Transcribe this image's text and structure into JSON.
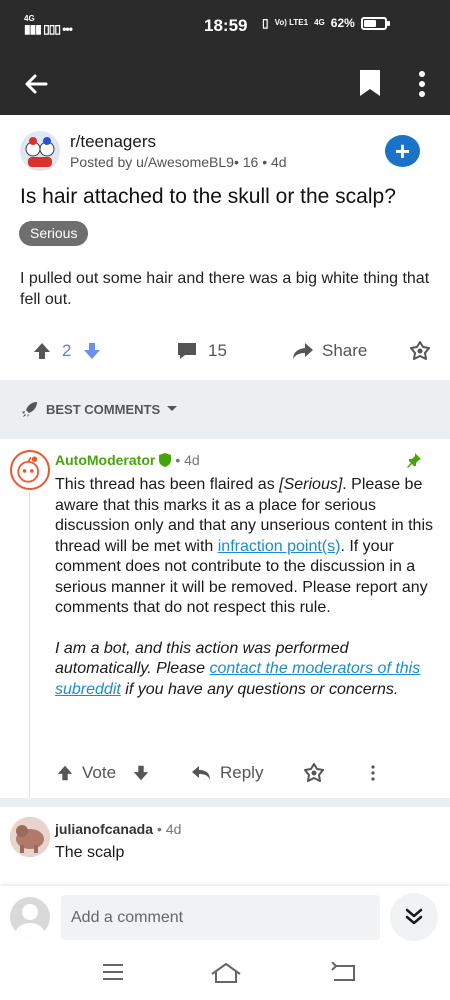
{
  "status_bar": {
    "network": "4G",
    "time": "18:59",
    "vo_lte": "Vo) LTE1",
    "network_right": "4G",
    "battery": "62%",
    "battery_level": 0.62
  },
  "post": {
    "subreddit": "r/teenagers",
    "posted_by": "Posted by u/AwesomeBL9",
    "posted_meta": "• 16 • 4d",
    "join_icon": "plus-icon",
    "title": "Is hair attached to the skull or the scalp?",
    "flair": "Serious",
    "body": "I pulled out some hair and there was a big white thing that fell out.",
    "score": "2",
    "comments": "15",
    "share_label": "Share"
  },
  "sort": {
    "label": "BEST COMMENTS"
  },
  "comments": [
    {
      "author": "AutoModerator",
      "age": "• 4d",
      "body_1a": "This thread has been flaired as ",
      "body_1b": "[Serious]",
      "body_1c": ". Please be aware that this marks it as a place for serious discussion only and that any unserious content in this thread will be met with ",
      "body_1_link": "infraction point(s)",
      "body_1d": ". If your comment does not contribute to the discussion in a serious manner it will be removed. Please report any comments that do not respect this rule.",
      "body_2a": "I am a bot, and this action was performed automatically. Please ",
      "body_2_link": "contact the moderators of this subreddit",
      "body_2b": " if you have any questions or concerns.",
      "vote_label": "Vote",
      "reply_label": "Reply"
    },
    {
      "author": "julianofcanada",
      "age": "• 4d",
      "body": "The scalp"
    }
  ],
  "composer": {
    "placeholder": "Add a comment"
  }
}
